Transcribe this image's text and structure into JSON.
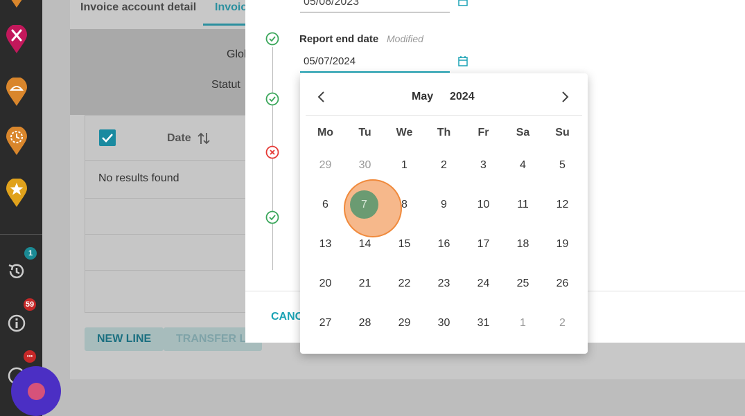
{
  "sidebar": {
    "history_badge": "1",
    "info_badge": "59",
    "more_badge": "•••",
    "colors": {
      "badge_teal": "#1b8a94",
      "badge_red": "#c62828"
    }
  },
  "background": {
    "tabs": [
      "Invoice account detail",
      "Invoic"
    ],
    "filter_labels": [
      "Glob",
      "Statut"
    ],
    "table": {
      "date_header": "Date",
      "empty_text": "No results found"
    },
    "buttons": {
      "new_line": "NEW LINE",
      "transfer": "TRANSFER LI"
    }
  },
  "modal": {
    "prev_date_value": "05/08/2023",
    "field_label": "Report end date",
    "field_status": "Modified",
    "field_value": "05/07/2024",
    "cancel_label": "CANC",
    "accent_color": "#1ba3b5"
  },
  "calendar": {
    "month": "May",
    "year": "2024",
    "weekdays": [
      "Mo",
      "Tu",
      "We",
      "Th",
      "Fr",
      "Sa",
      "Su"
    ],
    "weeks": [
      [
        "29",
        "30",
        "1",
        "2",
        "3",
        "4",
        "5"
      ],
      [
        "6",
        "7",
        "8",
        "9",
        "10",
        "11",
        "12"
      ],
      [
        "13",
        "14",
        "15",
        "16",
        "17",
        "18",
        "19"
      ],
      [
        "20",
        "21",
        "22",
        "23",
        "24",
        "25",
        "26"
      ],
      [
        "27",
        "28",
        "29",
        "30",
        "31",
        "1",
        "2"
      ]
    ],
    "selected_day": "7",
    "selected_color": "#6b9b72",
    "click_highlight_color": "#f3a064"
  }
}
